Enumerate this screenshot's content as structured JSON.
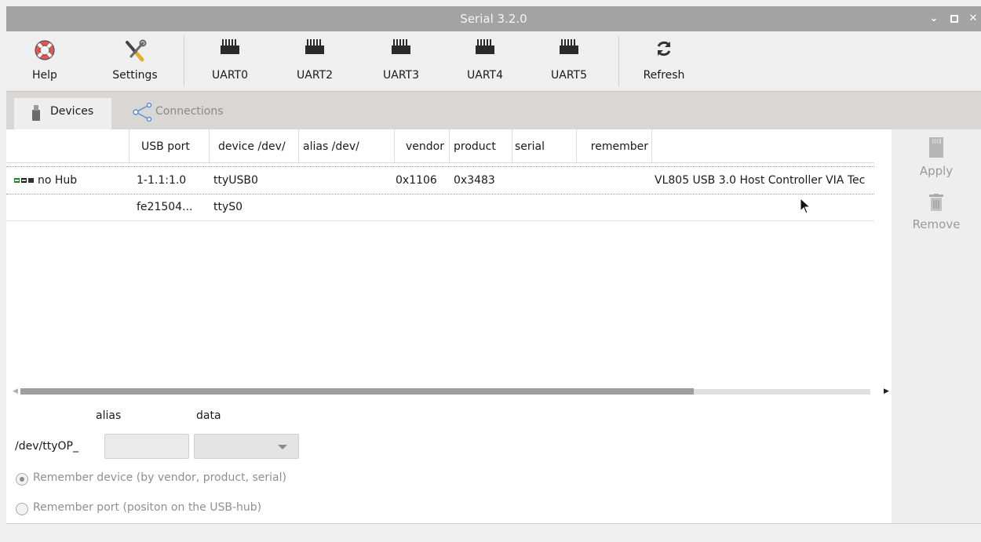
{
  "window": {
    "title": "Serial 3.2.0"
  },
  "toolbar": {
    "help": "Help",
    "settings": "Settings",
    "uart0": "UART0",
    "uart2": "UART2",
    "uart3": "UART3",
    "uart4": "UART4",
    "uart5": "UART5",
    "refresh": "Refresh"
  },
  "tabs": {
    "devices": "Devices",
    "connections": "Connections"
  },
  "table": {
    "headers": {
      "usb_port": "USB port",
      "device": "device /dev/",
      "alias": "alias /dev/",
      "vendor": "vendor",
      "product": "product",
      "serial": "serial",
      "remember": "remember"
    },
    "rows": [
      {
        "hub": "no Hub",
        "usb_port": "1-1.1:1.0",
        "device": "ttyUSB0",
        "alias": "",
        "vendor": "0x1106",
        "product": "0x3483",
        "serial": "",
        "remember": "",
        "description": "VL805 USB 3.0 Host Controller VIA Tec"
      },
      {
        "hub": "",
        "usb_port": "fe21504...",
        "device": "ttyS0",
        "alias": "",
        "vendor": "",
        "product": "",
        "serial": "",
        "remember": "",
        "description": ""
      }
    ]
  },
  "sidebar": {
    "apply": "Apply",
    "remove": "Remove"
  },
  "form": {
    "alias_label": "alias",
    "data_label": "data",
    "prefix": "/dev/ttyOP_",
    "alias_value": "",
    "data_value": "",
    "radio_device": "Remember device (by vendor, product, serial)",
    "radio_port": "Remember port (positon on the USB-hub)"
  }
}
